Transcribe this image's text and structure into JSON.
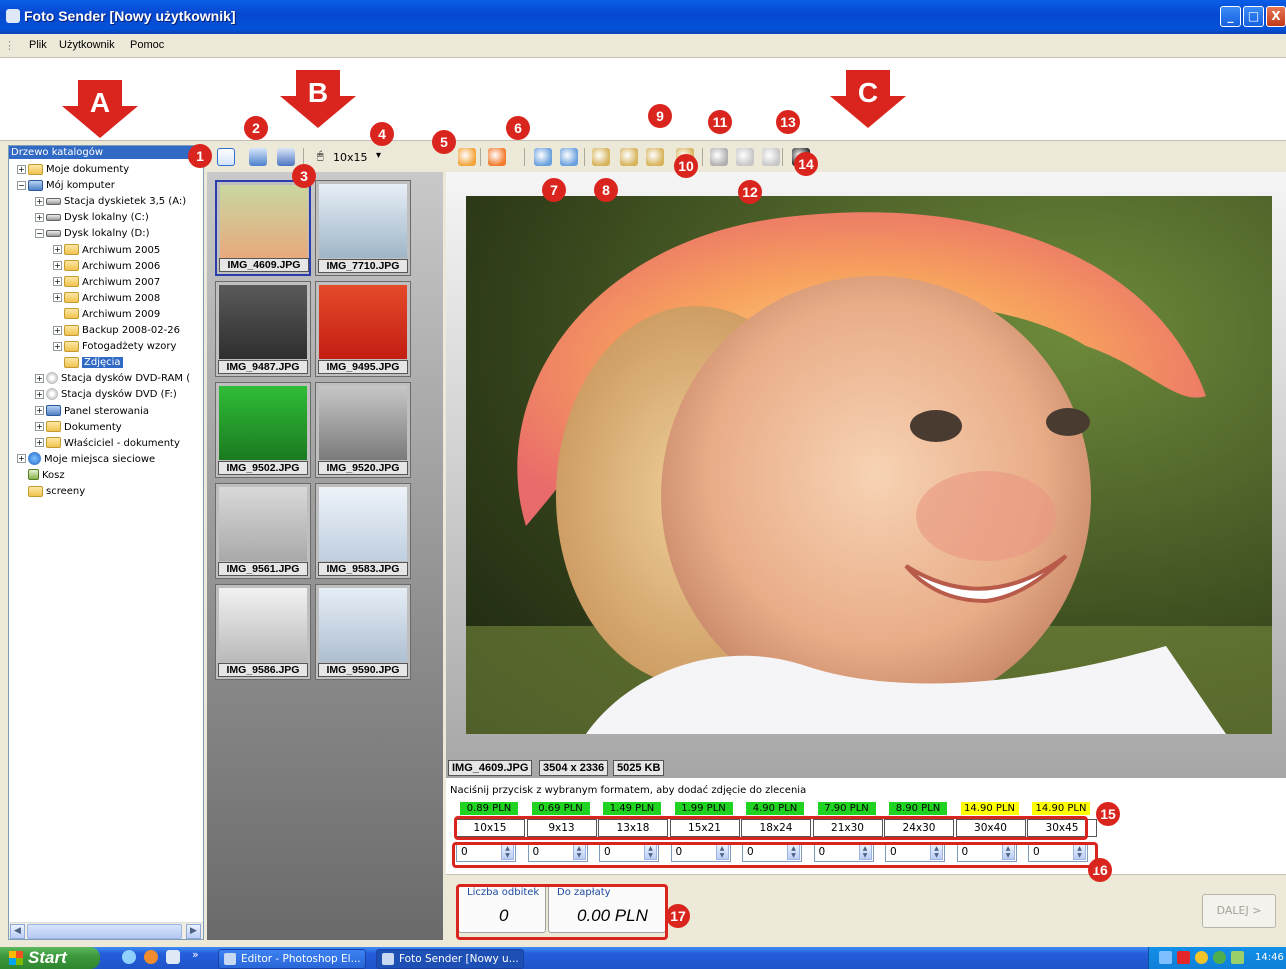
{
  "window": {
    "title": "Foto Sender [Nowy użytkownik]",
    "min": "_",
    "max": "□",
    "close": "X"
  },
  "menu": [
    "Plik",
    "Użytkownik",
    "Pomoc"
  ],
  "tree": {
    "header": "Drzewo katalogów",
    "nodes": [
      {
        "label": "Moje dokumenty",
        "icon": "folder-docs-icon",
        "exp": "+"
      },
      {
        "label": "Mój komputer",
        "icon": "computer-icon",
        "exp": "−"
      },
      {
        "label": "Stacja dyskietek 3,5 (A:)",
        "icon": "floppy-drive-icon",
        "exp": "+"
      },
      {
        "label": "Dysk lokalny (C:)",
        "icon": "hard-drive-icon",
        "exp": "+"
      },
      {
        "label": "Dysk lokalny (D:)",
        "icon": "hard-drive-icon",
        "exp": "−"
      },
      {
        "label": "Archiwum 2005",
        "icon": "folder-icon",
        "exp": "+"
      },
      {
        "label": "Archiwum 2006",
        "icon": "folder-icon",
        "exp": "+"
      },
      {
        "label": "Archiwum 2007",
        "icon": "folder-icon",
        "exp": "+"
      },
      {
        "label": "Archiwum 2008",
        "icon": "folder-icon",
        "exp": "+"
      },
      {
        "label": "Archiwum 2009",
        "icon": "folder-icon",
        "exp": ""
      },
      {
        "label": "Backup 2008-02-26",
        "icon": "folder-icon",
        "exp": "+"
      },
      {
        "label": "Fotogadżety wzory",
        "icon": "folder-icon",
        "exp": "+"
      },
      {
        "label": "Zdjęcia",
        "icon": "folder-open-icon",
        "exp": "",
        "selected": true
      },
      {
        "label": "Stacja dysków DVD-RAM (",
        "icon": "dvd-drive-icon",
        "exp": "+"
      },
      {
        "label": "Stacja dysków DVD (F:)",
        "icon": "dvd-drive-icon",
        "exp": "+"
      },
      {
        "label": "Panel sterowania",
        "icon": "control-panel-icon",
        "exp": "+"
      },
      {
        "label": "Dokumenty",
        "icon": "folder-icon",
        "exp": "+"
      },
      {
        "label": "Właściciel - dokumenty",
        "icon": "folder-icon",
        "exp": "+"
      },
      {
        "label": "Moje miejsca sieciowe",
        "icon": "network-icon",
        "exp": "+"
      },
      {
        "label": "Kosz",
        "icon": "recycle-bin-icon",
        "exp": ""
      },
      {
        "label": "screeny",
        "icon": "folder-icon",
        "exp": ""
      }
    ]
  },
  "thumb_toolbar": {
    "format": "10x15",
    "dropdown": "▾"
  },
  "thumbnails": [
    {
      "name": "IMG_4609.JPG",
      "selected": true
    },
    {
      "name": "IMG_7710.JPG"
    },
    {
      "name": "IMG_9487.JPG"
    },
    {
      "name": "IMG_9495.JPG"
    },
    {
      "name": "IMG_9502.JPG"
    },
    {
      "name": "IMG_9520.JPG"
    },
    {
      "name": "IMG_9561.JPG"
    },
    {
      "name": "IMG_9583.JPG"
    },
    {
      "name": "IMG_9586.JPG"
    },
    {
      "name": "IMG_9590.JPG"
    }
  ],
  "view_toolbar_icons": [
    "crop-tool-icon",
    "crop-cancel-icon",
    "rotate-left-icon",
    "rotate-right-icon",
    "zoom-in-icon",
    "zoom-out-icon",
    "zoom-fit-icon",
    "zoom-actual-icon",
    "copy-icon",
    "red-eye-icon",
    "undo-icon",
    "preview-icon"
  ],
  "image_info": {
    "name": "IMG_4609.JPG",
    "dimensions": "3504 x 2336",
    "size": "5025 KB"
  },
  "formats": {
    "instruction": "Naciśnij przycisk z wybranym formatem, aby dodać zdjęcie do zlecenia",
    "items": [
      {
        "price": "0.89 PLN",
        "size": "10x15",
        "qty": "0",
        "color": "#21d321"
      },
      {
        "price": "0.69 PLN",
        "size": "9x13",
        "qty": "0",
        "color": "#21d321"
      },
      {
        "price": "1.49 PLN",
        "size": "13x18",
        "qty": "0",
        "color": "#21d321"
      },
      {
        "price": "1.99 PLN",
        "size": "15x21",
        "qty": "0",
        "color": "#21d321"
      },
      {
        "price": "4.90 PLN",
        "size": "18x24",
        "qty": "0",
        "color": "#21d321"
      },
      {
        "price": "7.90 PLN",
        "size": "21x30",
        "qty": "0",
        "color": "#21d321"
      },
      {
        "price": "8.90 PLN",
        "size": "24x30",
        "qty": "0",
        "color": "#21d321"
      },
      {
        "price": "14.90 PLN",
        "size": "30x40",
        "qty": "0",
        "color": "#ffff00"
      },
      {
        "price": "14.90 PLN",
        "size": "30x45",
        "qty": "0",
        "color": "#ffff00"
      }
    ]
  },
  "summary": {
    "count_label": "Liczba odbitek",
    "count": "0",
    "pay_label": "Do zapłaty",
    "pay": "0.00 PLN",
    "next": "DALEJ >"
  },
  "annotations": {
    "arrows": [
      "A",
      "B",
      "C"
    ],
    "badges": [
      "1",
      "2",
      "3",
      "4",
      "5",
      "6",
      "7",
      "8",
      "9",
      "10",
      "11",
      "12",
      "13",
      "14",
      "15",
      "16",
      "17"
    ],
    "color": "#d9251d"
  },
  "taskbar": {
    "start": "Start",
    "more": "»",
    "tasks": [
      "Editor - Photoshop El...",
      "Foto Sender [Nowy u..."
    ],
    "clock": "14:46"
  }
}
